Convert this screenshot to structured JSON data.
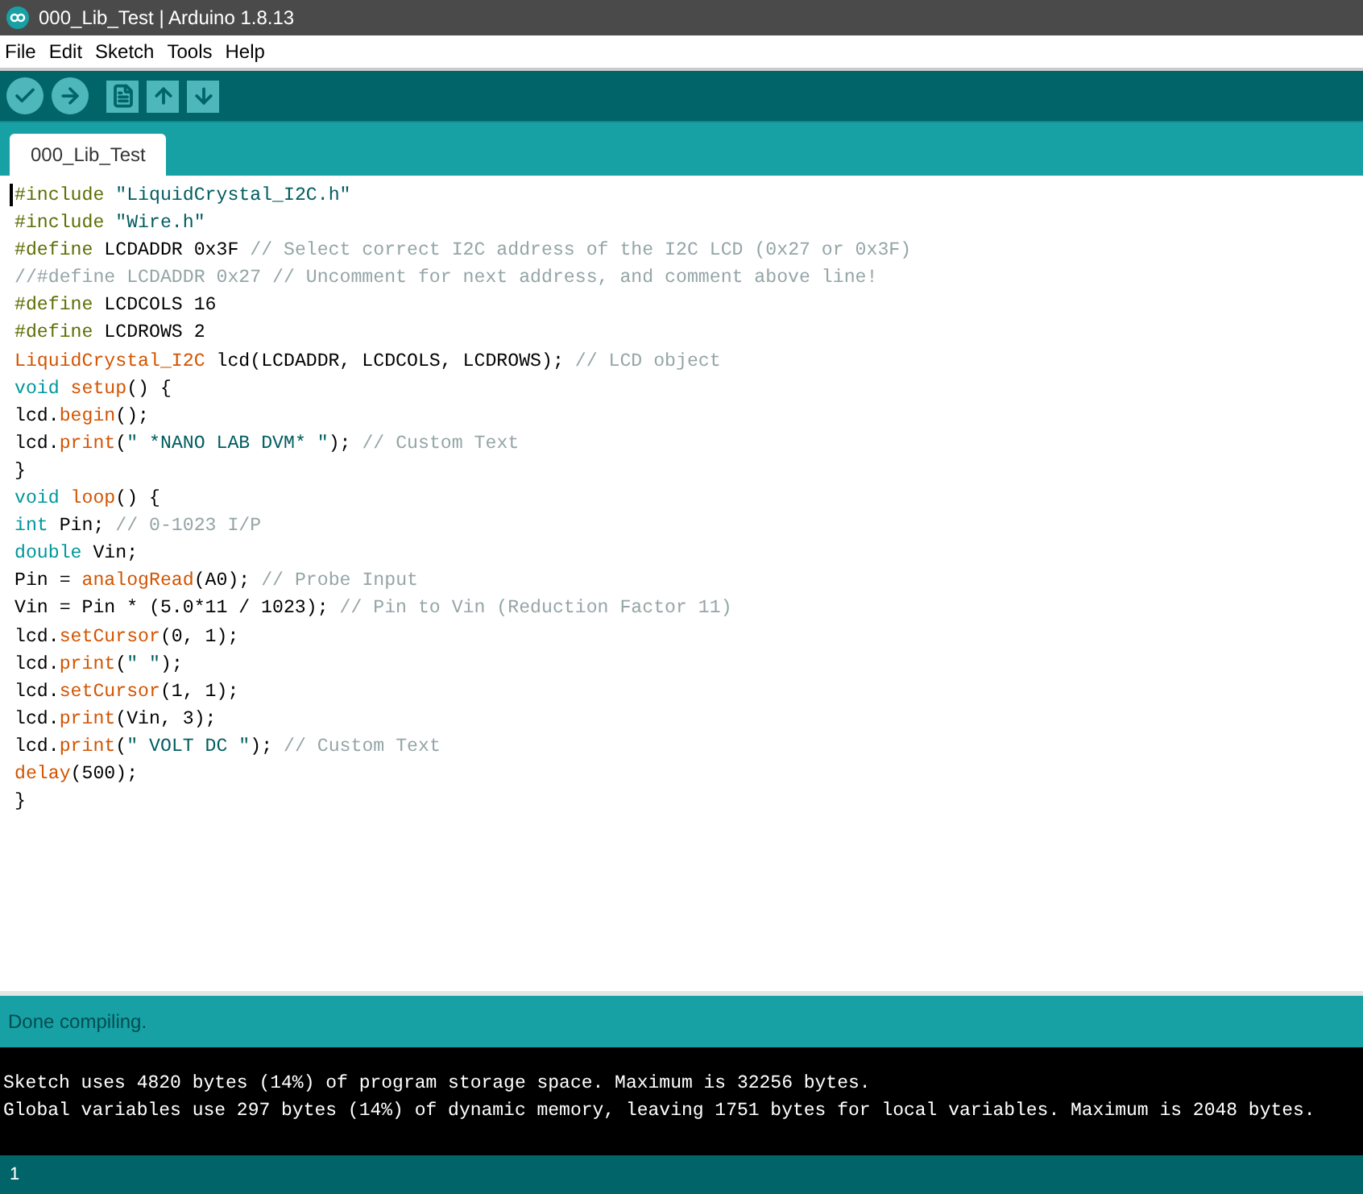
{
  "window": {
    "title": "000_Lib_Test | Arduino 1.8.13"
  },
  "menu": [
    "File",
    "Edit",
    "Sketch",
    "Tools",
    "Help"
  ],
  "toolbar": [
    {
      "kind": "verify"
    },
    {
      "kind": "upload"
    },
    {
      "kind": "new"
    },
    {
      "kind": "open"
    },
    {
      "kind": "save"
    }
  ],
  "tabs": [
    {
      "label": "000_Lib_Test",
      "selected": true
    }
  ],
  "editor": {
    "lines": [
      [
        {
          "kind": "directive",
          "text": "#include "
        },
        {
          "kind": "string",
          "text": "\"LiquidCrystal_I2C.h\""
        }
      ],
      [
        {
          "kind": "directive",
          "text": "#include "
        },
        {
          "kind": "string",
          "text": "\"Wire.h\""
        }
      ],
      [
        {
          "kind": "directive",
          "text": "#define"
        },
        {
          "kind": "plain",
          "text": " LCDADDR 0x3F "
        },
        {
          "kind": "comment",
          "text": "// Select correct I2C address of the I2C LCD (0x27 or 0x3F)"
        }
      ],
      [
        {
          "kind": "comment",
          "text": "//#define LCDADDR 0x27 // Uncomment for next address, and comment above line!"
        }
      ],
      [
        {
          "kind": "directive",
          "text": "#define"
        },
        {
          "kind": "plain",
          "text": " LCDCOLS 16"
        }
      ],
      [
        {
          "kind": "directive",
          "text": "#define"
        },
        {
          "kind": "plain",
          "text": " LCDROWS 2"
        }
      ],
      [
        {
          "kind": "function",
          "text": "LiquidCrystal_I2C"
        },
        {
          "kind": "plain",
          "text": " lcd(LCDADDR, LCDCOLS, LCDROWS); "
        },
        {
          "kind": "comment",
          "text": "// LCD object"
        }
      ],
      [
        {
          "kind": "type",
          "text": "void "
        },
        {
          "kind": "function",
          "text": "setup"
        },
        {
          "kind": "plain",
          "text": "() {"
        }
      ],
      [
        {
          "kind": "plain",
          "text": "lcd."
        },
        {
          "kind": "function",
          "text": "begin"
        },
        {
          "kind": "plain",
          "text": "();"
        }
      ],
      [
        {
          "kind": "plain",
          "text": "lcd."
        },
        {
          "kind": "function",
          "text": "print"
        },
        {
          "kind": "plain",
          "text": "("
        },
        {
          "kind": "string",
          "text": "\" *NANO LAB DVM* \""
        },
        {
          "kind": "plain",
          "text": "); "
        },
        {
          "kind": "comment",
          "text": "// Custom Text"
        }
      ],
      [
        {
          "kind": "plain",
          "text": "}"
        }
      ],
      [
        {
          "kind": "type",
          "text": "void "
        },
        {
          "kind": "function",
          "text": "loop"
        },
        {
          "kind": "plain",
          "text": "() {"
        }
      ],
      [
        {
          "kind": "type",
          "text": "int"
        },
        {
          "kind": "plain",
          "text": " Pin; "
        },
        {
          "kind": "comment",
          "text": "// 0-1023 I/P"
        }
      ],
      [
        {
          "kind": "type",
          "text": "double"
        },
        {
          "kind": "plain",
          "text": " Vin;"
        }
      ],
      [
        {
          "kind": "plain",
          "text": "Pin = "
        },
        {
          "kind": "function",
          "text": "analogRead"
        },
        {
          "kind": "plain",
          "text": "(A0); "
        },
        {
          "kind": "comment",
          "text": "// Probe Input"
        }
      ],
      [
        {
          "kind": "plain",
          "text": "Vin = Pin * (5.0*11 / 1023); "
        },
        {
          "kind": "comment",
          "text": "// Pin to Vin (Reduction Factor 11)"
        }
      ],
      [
        {
          "kind": "plain",
          "text": "lcd."
        },
        {
          "kind": "function",
          "text": "setCursor"
        },
        {
          "kind": "plain",
          "text": "(0, 1);"
        }
      ],
      [
        {
          "kind": "plain",
          "text": "lcd."
        },
        {
          "kind": "function",
          "text": "print"
        },
        {
          "kind": "plain",
          "text": "("
        },
        {
          "kind": "string",
          "text": "\" \""
        },
        {
          "kind": "plain",
          "text": ");"
        }
      ],
      [
        {
          "kind": "plain",
          "text": "lcd."
        },
        {
          "kind": "function",
          "text": "setCursor"
        },
        {
          "kind": "plain",
          "text": "(1, 1);"
        }
      ],
      [
        {
          "kind": "plain",
          "text": "lcd."
        },
        {
          "kind": "function",
          "text": "print"
        },
        {
          "kind": "plain",
          "text": "(Vin, 3);"
        }
      ],
      [
        {
          "kind": "plain",
          "text": "lcd."
        },
        {
          "kind": "function",
          "text": "print"
        },
        {
          "kind": "plain",
          "text": "("
        },
        {
          "kind": "string",
          "text": "\" VOLT DC \""
        },
        {
          "kind": "plain",
          "text": "); "
        },
        {
          "kind": "comment",
          "text": "// Custom Text"
        }
      ],
      [
        {
          "kind": "function",
          "text": "delay"
        },
        {
          "kind": "plain",
          "text": "(500);"
        }
      ],
      [
        {
          "kind": "plain",
          "text": "}"
        }
      ]
    ]
  },
  "status": "Done compiling.",
  "console": [
    "Sketch uses 4820 bytes (14%) of program storage space. Maximum is 32256 bytes.",
    "Global variables use 297 bytes (14%) of dynamic memory, leaving 1751 bytes for local variables. Maximum is 2048 bytes."
  ],
  "status_bar": {
    "line": "1"
  }
}
